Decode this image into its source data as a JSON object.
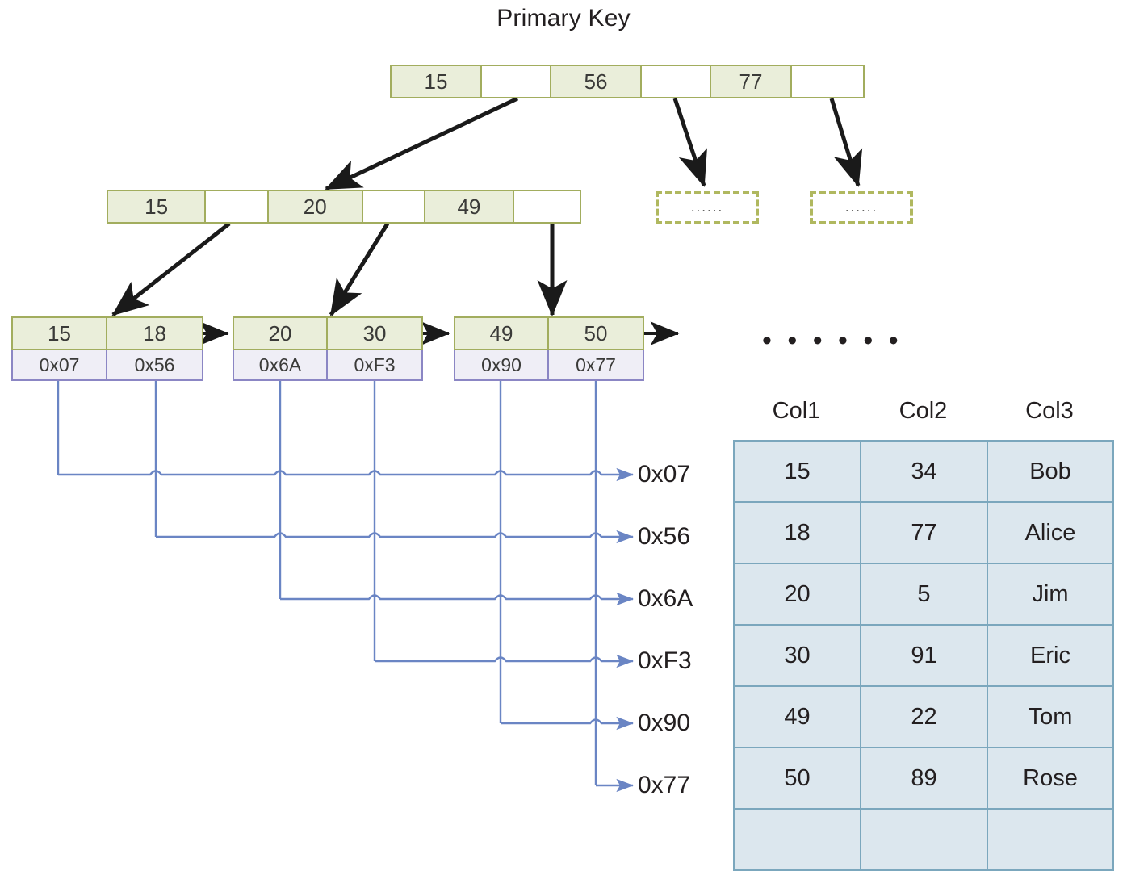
{
  "title": "Primary Key",
  "tree": {
    "root": {
      "cells": [
        {
          "type": "key",
          "label": "15"
        },
        {
          "type": "ptr",
          "label": ""
        },
        {
          "type": "key",
          "label": "56"
        },
        {
          "type": "ptr",
          "label": ""
        },
        {
          "type": "key",
          "label": "77"
        },
        {
          "type": "ptr",
          "label": ""
        }
      ]
    },
    "internal": {
      "cells": [
        {
          "type": "key",
          "label": "15"
        },
        {
          "type": "ptr",
          "label": ""
        },
        {
          "type": "key",
          "label": "20"
        },
        {
          "type": "ptr",
          "label": ""
        },
        {
          "type": "key",
          "label": "49"
        },
        {
          "type": "ptr",
          "label": ""
        }
      ]
    },
    "placeholders": [
      {
        "label": "......"
      },
      {
        "label": "......"
      }
    ],
    "leaves": [
      {
        "keys": [
          "15",
          "18"
        ],
        "pointers": [
          "0x07",
          "0x56"
        ]
      },
      {
        "keys": [
          "20",
          "30"
        ],
        "pointers": [
          "0x6A",
          "0xF3"
        ]
      },
      {
        "keys": [
          "49",
          "50"
        ],
        "pointers": [
          "0x90",
          "0x77"
        ]
      }
    ],
    "leaf_row_ellipsis": "• • • • • •"
  },
  "addresses": [
    {
      "label": "0x07"
    },
    {
      "label": "0x56"
    },
    {
      "label": "0x6A"
    },
    {
      "label": "0xF3"
    },
    {
      "label": "0x90"
    },
    {
      "label": "0x77"
    }
  ],
  "table": {
    "headers": [
      "Col1",
      "Col2",
      "Col3"
    ],
    "rows": [
      [
        "15",
        "34",
        "Bob"
      ],
      [
        "18",
        "77",
        "Alice"
      ],
      [
        "20",
        "5",
        "Jim"
      ],
      [
        "30",
        "91",
        "Eric"
      ],
      [
        "49",
        "22",
        "Tom"
      ],
      [
        "50",
        "89",
        "Rose"
      ]
    ]
  },
  "colors": {
    "key_fill": "#eaeeda",
    "key_border": "#a2ad5e",
    "pointer_fill": "#efeef6",
    "pointer_border": "#8b86c4",
    "table_fill": "#dce7ee",
    "table_border": "#7ba7bd",
    "connector_line": "#6a85c4",
    "arrow_black": "#1a1a1a",
    "text": "#231f20"
  }
}
